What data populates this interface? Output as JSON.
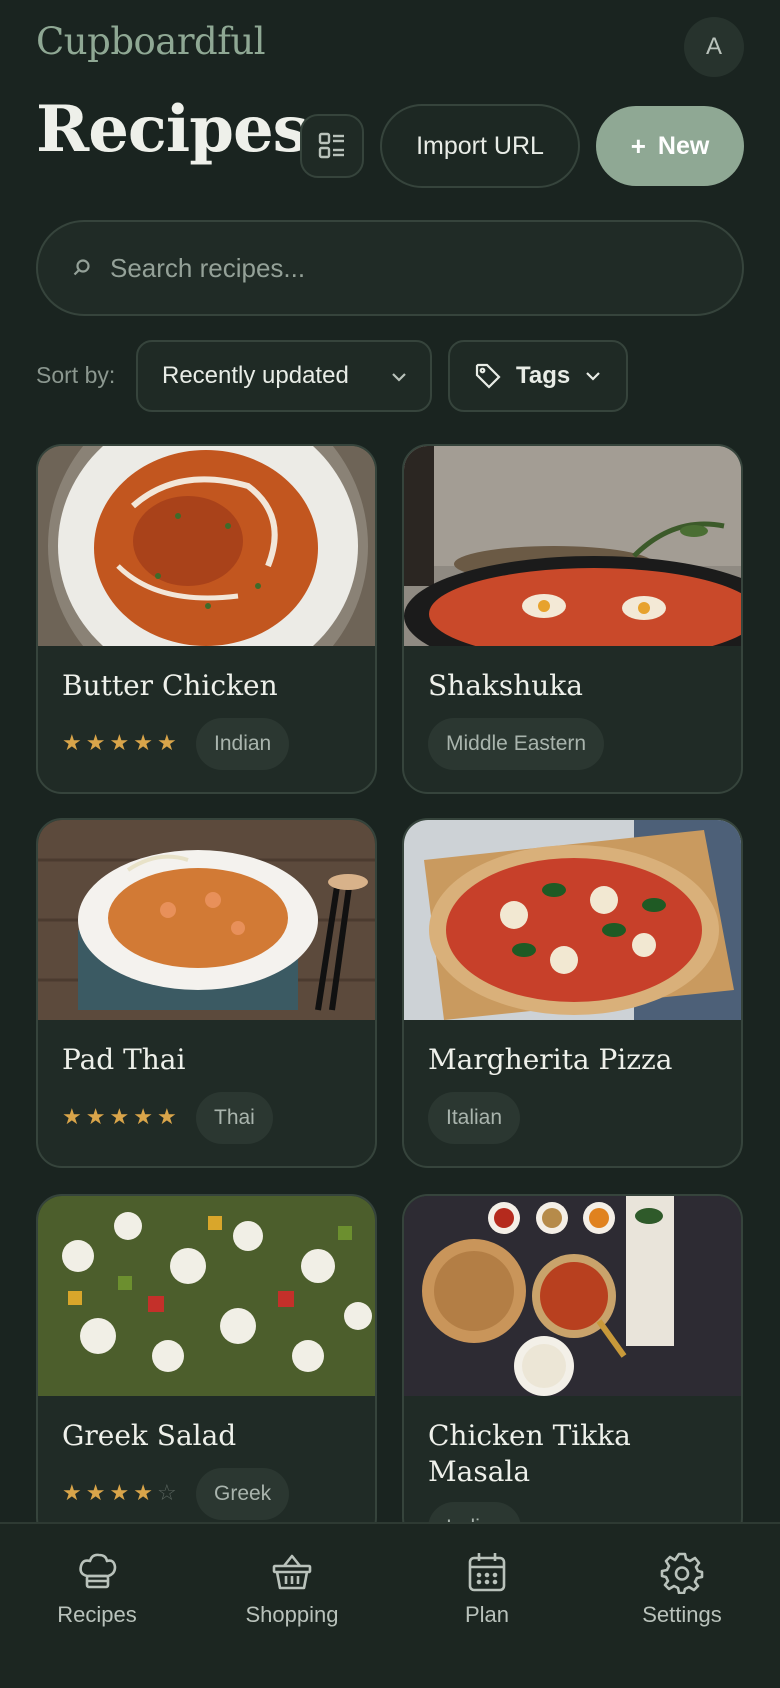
{
  "app": {
    "brand": "Cupboardful",
    "avatar_initial": "A"
  },
  "header": {
    "title": "Recipes",
    "import_label": "Import URL",
    "new_label": "New"
  },
  "search": {
    "placeholder": "Search recipes..."
  },
  "filters": {
    "sort_label": "Sort by:",
    "sort_value": "Recently updated",
    "tags_label": "Tags"
  },
  "recipes": [
    {
      "name": "Butter Chicken",
      "rating": 5,
      "tag": "Indian"
    },
    {
      "name": "Shakshuka",
      "rating": null,
      "tag": "Middle Eastern"
    },
    {
      "name": "Pad Thai",
      "rating": 5,
      "tag": "Thai"
    },
    {
      "name": "Margherita Pizza",
      "rating": null,
      "tag": "Italian"
    },
    {
      "name": "Greek Salad",
      "rating": 4,
      "tag": "Greek"
    },
    {
      "name": "Chicken Tikka Masala",
      "rating": null,
      "tag": "Indian"
    }
  ],
  "nav": [
    {
      "label": "Recipes",
      "icon": "chef-hat-icon"
    },
    {
      "label": "Shopping",
      "icon": "basket-icon"
    },
    {
      "label": "Plan",
      "icon": "calendar-icon"
    },
    {
      "label": "Settings",
      "icon": "gear-icon"
    }
  ],
  "colors": {
    "accent": "#8fa894",
    "star": "#d9a54a",
    "background": "#1a2420"
  }
}
